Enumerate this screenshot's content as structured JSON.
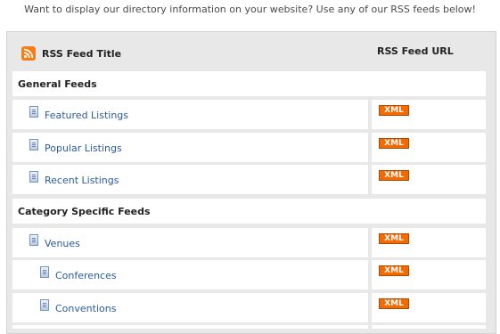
{
  "intro": "Want to display our directory information on your website? Use any of our RSS feeds below!",
  "header": {
    "title_col": "RSS Feed Title",
    "url_col": "RSS Feed URL",
    "icon": "rss-icon"
  },
  "sections": [
    {
      "title": "General Feeds",
      "items": [
        {
          "label": "Featured Listings",
          "badge": "XML"
        },
        {
          "label": "Popular Listings",
          "badge": "XML"
        },
        {
          "label": "Recent Listings",
          "badge": "XML"
        }
      ]
    },
    {
      "title": "Category Specific Feeds",
      "items": [
        {
          "label": "Venues",
          "badge": "XML"
        },
        {
          "label": "Conferences",
          "badge": "XML"
        },
        {
          "label": "Conventions",
          "badge": "XML"
        }
      ]
    }
  ],
  "colors": {
    "panel_bg": "#e8e8e8",
    "link": "#2a5a9e",
    "xml_badge": "#f26a00",
    "rss_icon": "#f57d17"
  }
}
